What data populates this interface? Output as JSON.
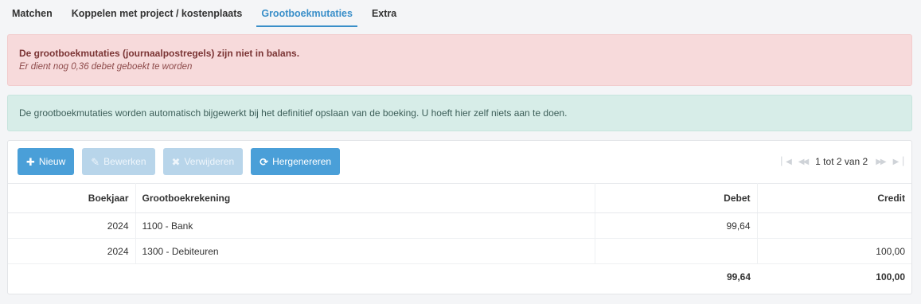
{
  "tabs": [
    {
      "label": "Matchen",
      "active": false
    },
    {
      "label": "Koppelen met project / kostenplaats",
      "active": false
    },
    {
      "label": "Grootboekmutaties",
      "active": true
    },
    {
      "label": "Extra",
      "active": false
    }
  ],
  "alert_danger": {
    "title": "De grootboekmutaties (journaalpostregels) zijn niet in balans.",
    "message": "Er dient nog 0,36 debet geboekt te worden"
  },
  "alert_info": {
    "message": "De grootboekmutaties worden automatisch bijgewerkt bij het definitief opslaan van de boeking. U hoeft hier zelf niets aan te doen."
  },
  "toolbar": {
    "new_label": "Nieuw",
    "edit_label": "Bewerken",
    "delete_label": "Verwijderen",
    "regenerate_label": "Hergenereren"
  },
  "pager": {
    "summary": "1 tot 2 van 2"
  },
  "table": {
    "headers": {
      "year": "Boekjaar",
      "account": "Grootboekrekening",
      "debet": "Debet",
      "credit": "Credit"
    },
    "rows": [
      {
        "year": "2024",
        "account": "1100 - Bank",
        "debet": "99,64",
        "credit": ""
      },
      {
        "year": "2024",
        "account": "1300 - Debiteuren",
        "debet": "",
        "credit": "100,00"
      }
    ],
    "totals": {
      "debet": "99,64",
      "credit": "100,00"
    }
  },
  "colors": {
    "accent": "#3a8fc9",
    "primary_button": "#4a9fd8",
    "danger_bg": "#f7dadb",
    "info_bg": "#d7ede8"
  }
}
